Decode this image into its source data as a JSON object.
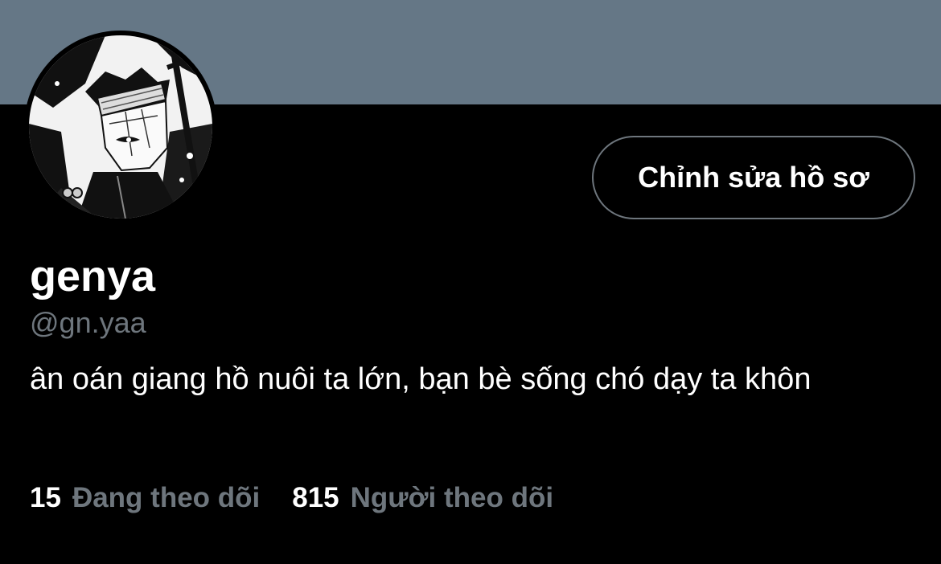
{
  "profile": {
    "display_name": "genya",
    "handle": "@gn.yaa",
    "bio": "ân oán giang hồ nuôi ta lớn, bạn bè sống chó dạy ta khôn",
    "edit_button_label": "Chỉnh sửa hồ sơ",
    "avatar_icon": "manga-avatar-image"
  },
  "stats": {
    "following_count": "15",
    "following_label": "Đang theo dõi",
    "followers_count": "815",
    "followers_label": "Người theo dõi"
  },
  "colors": {
    "banner": "#657786",
    "background": "#000000",
    "text_primary": "#ffffff",
    "text_secondary": "#6e767d",
    "button_border": "#6e767d"
  }
}
